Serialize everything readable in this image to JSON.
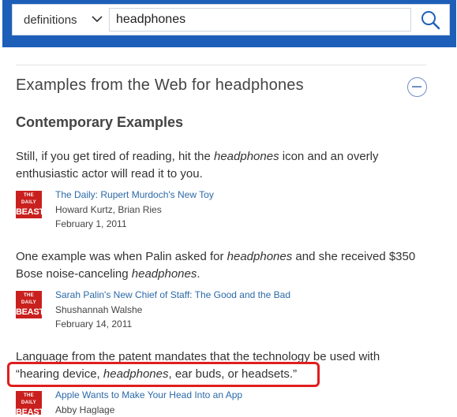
{
  "search": {
    "dictionary_label": "definitions",
    "query": "headphones"
  },
  "examples": {
    "section_title": "Examples from the Web for headphones",
    "subsection_title": "Contemporary Examples",
    "items": [
      {
        "quote_parts": [
          "Still, if you get tired of reading, hit the ",
          "headphones",
          " icon and an overly enthusiastic actor will read it to you."
        ],
        "logo": {
          "line1": "THE DAILY",
          "line2": "BEAST"
        },
        "title": "The Daily: Rupert Murdoch's New Toy",
        "author": "Howard Kurtz, Brian Ries",
        "date": "February 1, 2011"
      },
      {
        "quote_parts": [
          "One example was when Palin asked for ",
          "headphones",
          " and she received $350 Bose noise-canceling ",
          "headphones",
          "."
        ],
        "logo": {
          "line1": "THE DAILY",
          "line2": "BEAST"
        },
        "title": "Sarah Palin's New Chief of Staff: The Good and the Bad",
        "author": "Shushannah Walshe",
        "date": "February 14, 2011"
      },
      {
        "quote_parts": [
          "Language from the patent mandates that the technology be used with “hearing device, ",
          "headphones",
          ", ear buds, or headsets.”"
        ],
        "logo": {
          "line1": "THE DAILY",
          "line2": "BEAST"
        },
        "title": "Apple Wants to Make Your Head Into an App",
        "author": "Abby Haglage",
        "date": ""
      }
    ]
  },
  "colors": {
    "header_blue": "#1d5fb8",
    "link": "#2c6aa8",
    "logo_red": "#c9201e",
    "highlight_red": "#e01e1e"
  }
}
